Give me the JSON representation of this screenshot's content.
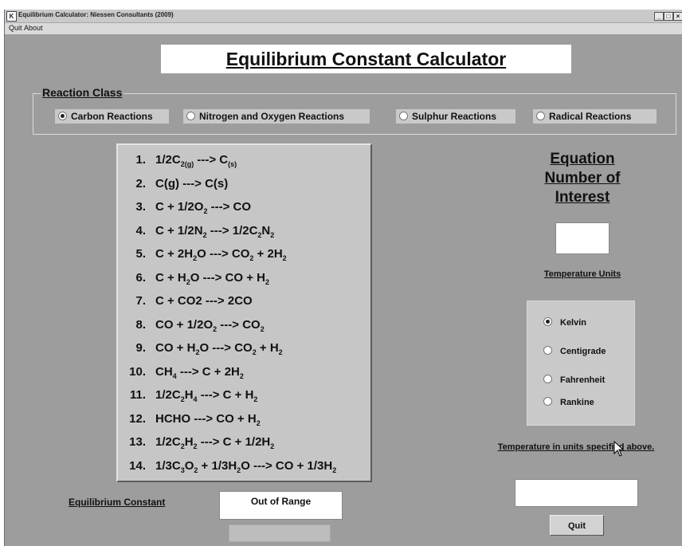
{
  "window": {
    "title": "Equilibrium Calculator: Niessen Consultants (2009)",
    "icon_letter": "K",
    "buttons": [
      "minimize-icon",
      "maximize-icon",
      "close-icon"
    ]
  },
  "menu": {
    "quit": "Quit",
    "about": "About"
  },
  "heading": "Equilibrium Constant Calculator",
  "reaction_class": {
    "label": "Reaction Class",
    "options": [
      {
        "label": "Carbon Reactions",
        "selected": true
      },
      {
        "label": "Nitrogen and Oxygen Reactions",
        "selected": false
      },
      {
        "label": "Sulphur Reactions",
        "selected": false
      },
      {
        "label": "Radical Reactions",
        "selected": false
      }
    ]
  },
  "equations": [
    {
      "num": "1.",
      "html": "1/2C<sub>2(g)</sub> ---&gt; C<sub>(s)</sub>"
    },
    {
      "num": "2.",
      "html": "C(g) ---&gt; C(s)"
    },
    {
      "num": "3.",
      "html": "C + 1/2O<sub>2</sub> ---&gt; CO"
    },
    {
      "num": "4.",
      "html": "C + 1/2N<sub>2</sub> ---&gt; 1/2C<sub>2</sub>N<sub>2</sub>"
    },
    {
      "num": "5.",
      "html": "C + 2H<sub>2</sub>O ---&gt; CO<sub>2</sub> + 2H<sub>2</sub>"
    },
    {
      "num": "6.",
      "html": "C + H<sub>2</sub>O ---&gt; CO + H<sub>2</sub>"
    },
    {
      "num": "7.",
      "html": "C + CO2 ---&gt; 2CO"
    },
    {
      "num": "8.",
      "html": "CO + 1/2O<sub>2</sub> ---&gt; CO<sub>2</sub>"
    },
    {
      "num": "9.",
      "html": "CO + H<sub>2</sub>O ---&gt; CO<sub>2</sub> + H<sub>2</sub>"
    },
    {
      "num": "10.",
      "html": "CH<sub>4</sub> ---&gt; C + 2H<sub>2</sub>"
    },
    {
      "num": "11.",
      "html": "1/2C<sub>2</sub>H<sub>4</sub> ---&gt; C + H<sub>2</sub>"
    },
    {
      "num": "12.",
      "html": "HCHO ---&gt; CO + H<sub>2</sub>"
    },
    {
      "num": "13.",
      "html": "1/2C<sub>2</sub>H<sub>2</sub> ---&gt; C + 1/2H<sub>2</sub>"
    },
    {
      "num": "14.",
      "html": "1/3C<sub>3</sub>O<sub>2</sub> + 1/3H<sub>2</sub>O ---&gt; CO + 1/3H<sub>2</sub>"
    }
  ],
  "equation_interest": {
    "label": "Equation Number of Interest",
    "value": ""
  },
  "temperature_units": {
    "label": "Temperature Units",
    "options": [
      {
        "label": "Kelvin",
        "selected": true
      },
      {
        "label": "Centigrade",
        "selected": false
      },
      {
        "label": "Fahrenheit",
        "selected": false
      },
      {
        "label": "Rankine",
        "selected": false
      }
    ]
  },
  "temperature_input": {
    "label": "Temperature in units specified above.",
    "value": ""
  },
  "quit_button": "Quit",
  "equilibrium": {
    "label": "Equilibrium Constant",
    "value": "Out of Range"
  },
  "colors": {
    "background": "#9d9d9d",
    "panel": "#c6c6c6",
    "field": "#ffffff"
  }
}
